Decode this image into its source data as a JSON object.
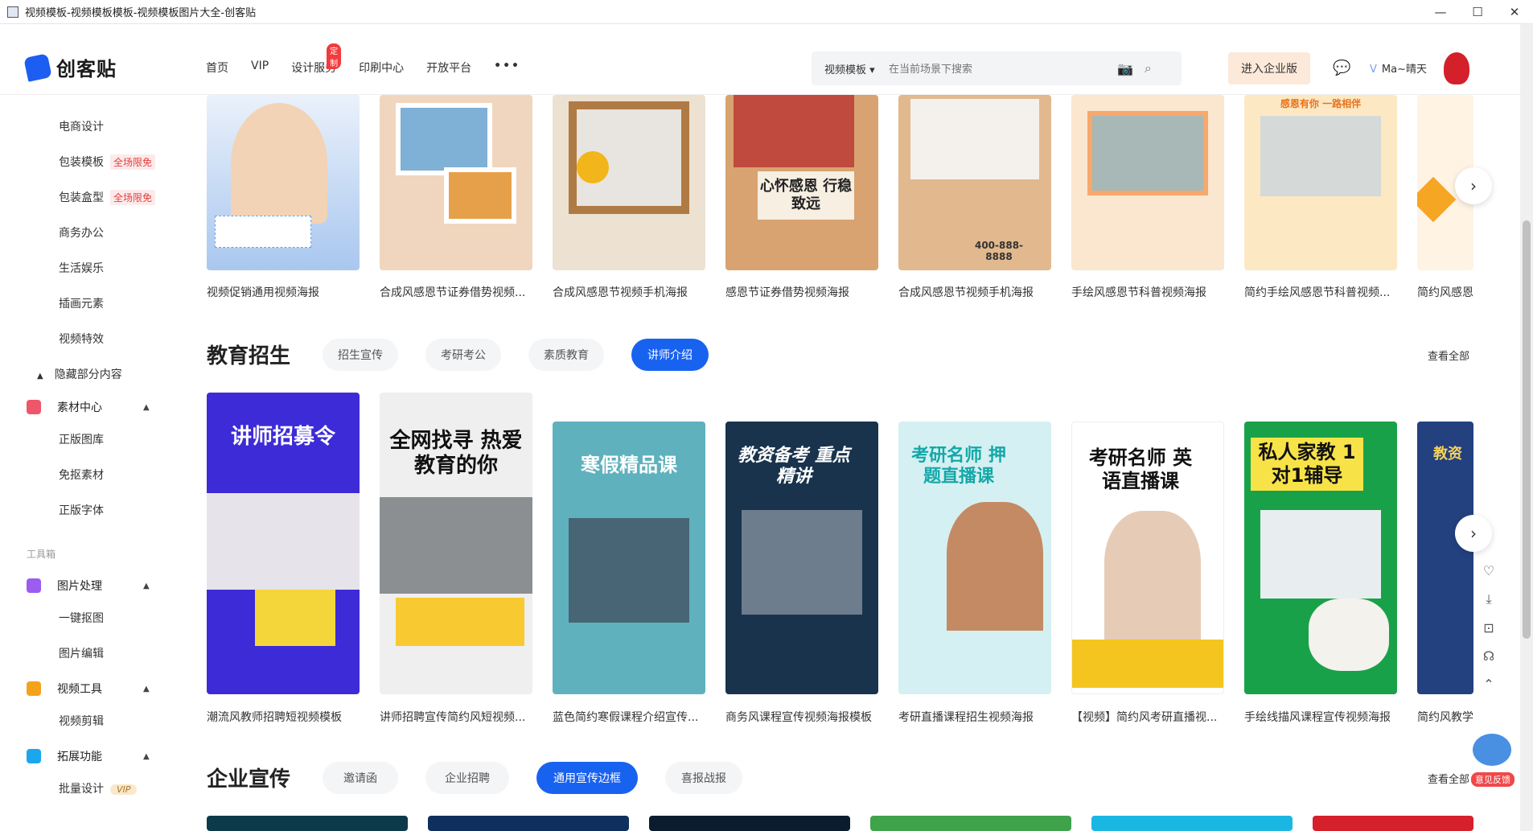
{
  "window": {
    "title": "视频模板-视频模板模板-视频模板图片大全-创客贴",
    "controls": [
      "—",
      "☐",
      "✕"
    ]
  },
  "header": {
    "logo": "创客贴",
    "nav": [
      {
        "label": "首页"
      },
      {
        "label": "VIP"
      },
      {
        "label": "设计服务",
        "badge": "定制"
      },
      {
        "label": "印刷中心"
      },
      {
        "label": "开放平台"
      },
      {
        "label": "•••"
      }
    ],
    "search": {
      "type": "视频模板",
      "placeholder": "在当前场景下搜索"
    },
    "enterprise_button": "进入企业版",
    "user_name": "Ma~晴天"
  },
  "sidebar": {
    "items_top": [
      {
        "label": "电商设计"
      },
      {
        "label": "包装模板",
        "tag": "全场限免"
      },
      {
        "label": "包装盒型",
        "tag": "全场限免"
      },
      {
        "label": "商务办公"
      },
      {
        "label": "生活娱乐"
      },
      {
        "label": "插画元素"
      },
      {
        "label": "视频特效"
      }
    ],
    "hidden_toggle": "隐藏部分内容",
    "material_center": {
      "label": "素材中心",
      "children": [
        "正版图库",
        "免抠素材",
        "正版字体"
      ]
    },
    "toolbox_label": "工具箱",
    "image_processing": {
      "label": "图片处理",
      "children": [
        "一键抠图",
        "图片编辑"
      ]
    },
    "video_tools": {
      "label": "视频工具",
      "children": [
        "视频剪辑"
      ]
    },
    "extensions": {
      "label": "拓展功能",
      "children": [
        {
          "label": "批量设计",
          "tag": "VIP"
        }
      ]
    }
  },
  "row1": {
    "cards": [
      {
        "title": "视频促销通用视频海报"
      },
      {
        "title": "合成风感恩节证券借势视频..."
      },
      {
        "title": "合成风感恩节视频手机海报"
      },
      {
        "title": "感恩节证券借势视频海报"
      },
      {
        "title": "合成风感恩节视频手机海报"
      },
      {
        "title": "手绘风感恩节科普视频海报"
      },
      {
        "title": "简约手绘风感恩节科普视频..."
      },
      {
        "title": "简约风感恩"
      }
    ],
    "card_texts": [
      "心怀感恩 行稳致远",
      "感恩有你 一路相伴",
      "400-888-8888"
    ]
  },
  "education": {
    "title": "教育招生",
    "tabs": [
      "招生宣传",
      "考研考公",
      "素质教育",
      "讲师介绍"
    ],
    "active_tab": "讲师介绍",
    "see_all": "查看全部",
    "cards": [
      {
        "title": "潮流风教师招聘短视频模板",
        "poster": "讲师招募令"
      },
      {
        "title": "讲师招聘宣传简约风短视频...",
        "poster": "全网找寻 热爱教育的你"
      },
      {
        "title": "蓝色简约寒假课程介绍宣传...",
        "poster": "寒假精品课"
      },
      {
        "title": "商务风课程宣传视频海报模板",
        "poster": "教资备考 重点精讲"
      },
      {
        "title": "考研直播课程招生视频海报",
        "poster": "考研名师 押题直播课"
      },
      {
        "title": "【视频】简约风考研直播视...",
        "poster": "考研名师 英语直播课"
      },
      {
        "title": "手绘线描风课程宣传视频海报",
        "poster": "私人家教 1对1辅导"
      },
      {
        "title": "简约风教学",
        "poster": "教资"
      }
    ]
  },
  "enterprise": {
    "title": "企业宣传",
    "tabs": [
      "邀请函",
      "企业招聘",
      "通用宣传边框",
      "喜报战报"
    ],
    "active_tab": "通用宣传边框",
    "see_all": "查看全部"
  },
  "float_tools": [
    "heart-icon",
    "download-icon",
    "cart-icon",
    "headset-icon",
    "up-icon"
  ],
  "feedback_label": "意见反馈"
}
